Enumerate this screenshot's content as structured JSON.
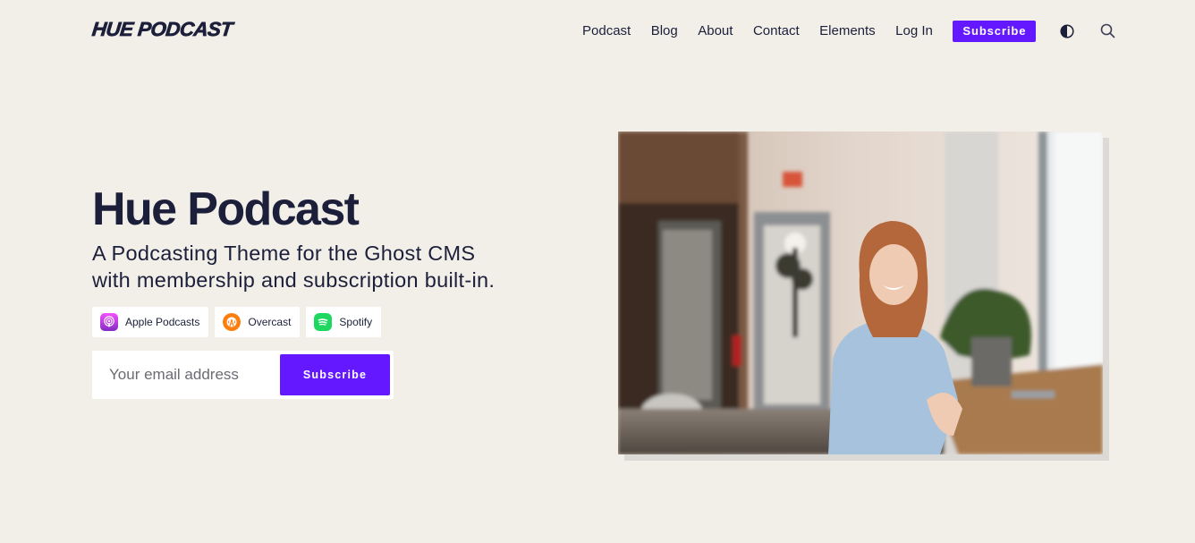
{
  "header": {
    "logo": "HUE PODCAST",
    "nav": [
      {
        "label": "Podcast"
      },
      {
        "label": "Blog"
      },
      {
        "label": "About"
      },
      {
        "label": "Contact"
      },
      {
        "label": "Elements"
      },
      {
        "label": "Log In"
      }
    ],
    "subscribe_label": "Subscribe",
    "theme_toggle_icon": "half-circle-contrast-icon",
    "search_icon": "search-icon"
  },
  "hero": {
    "title": "Hue Podcast",
    "subtitle": "A Podcasting Theme for the Ghost CMS with membership and subscription built-in.",
    "platforms": [
      {
        "label": "Apple Podcasts",
        "icon": "apple-podcasts-icon",
        "color": "#b150e2"
      },
      {
        "label": "Overcast",
        "icon": "overcast-icon",
        "color": "#fc7e0f"
      },
      {
        "label": "Spotify",
        "icon": "spotify-icon",
        "color": "#1ed760"
      }
    ],
    "email_placeholder": "Your email address",
    "email_value": "",
    "subscribe_label": "Subscribe",
    "image_alt": "Smiling woman with red hair sitting at a wooden window counter next to a potted plant"
  },
  "colors": {
    "background": "#f2efe9",
    "accent": "#6318ff",
    "text": "#1c1f3a"
  }
}
